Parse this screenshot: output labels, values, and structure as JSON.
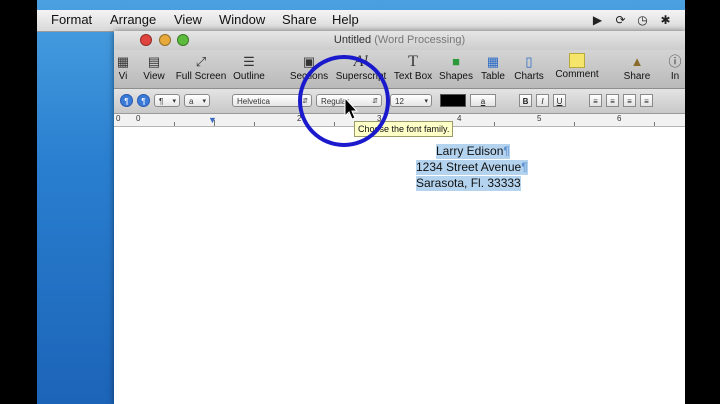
{
  "menubar": {
    "items": [
      "Format",
      "Arrange",
      "View",
      "Window",
      "Share",
      "Help"
    ],
    "status_icons": [
      "video-icon",
      "sync-icon",
      "time-machine-icon",
      "bluetooth-icon"
    ]
  },
  "window": {
    "title": "Untitled",
    "title_suffix": "(Word Processing)"
  },
  "toolbar": {
    "items": [
      {
        "label": "Vi",
        "icon": "view-icon"
      },
      {
        "label": "View",
        "icon": "view-menu-icon"
      },
      {
        "label": "Full Screen",
        "icon": "fullscreen-icon"
      },
      {
        "label": "Outline",
        "icon": "outline-icon"
      },
      {
        "label": "Sections",
        "icon": "sections-icon"
      },
      {
        "label": "Superscript",
        "icon": "superscript-icon"
      },
      {
        "label": "Text Box",
        "icon": "textbox-icon"
      },
      {
        "label": "Shapes",
        "icon": "shapes-icon"
      },
      {
        "label": "Table",
        "icon": "table-icon"
      },
      {
        "label": "Charts",
        "icon": "charts-icon"
      },
      {
        "label": "Comment",
        "icon": "comment-icon"
      },
      {
        "label": "Share",
        "icon": "share-icon"
      },
      {
        "label": "In",
        "icon": "inspector-icon"
      }
    ]
  },
  "formatbar": {
    "style_value": "¶",
    "char_style_value": "a",
    "font_family": "Helvetica",
    "font_typeface": "Regular",
    "font_size": "12",
    "text_color": "#000000",
    "highlight_label": "a",
    "bold": "B",
    "italic": "I",
    "underline": "U"
  },
  "ruler": {
    "numbers": [
      "0",
      "0",
      "2",
      "3",
      "4",
      "5",
      "6"
    ]
  },
  "tooltip": {
    "text": "Choose the font family."
  },
  "document": {
    "lines": [
      "Larry Edison",
      "1234 Street Avenue",
      "Sarasota, Fl. 33333"
    ],
    "pilcrow": "¶"
  },
  "colors": {
    "annotation_circle": "#1a1acc",
    "selection": "#b4d3ee",
    "desktop": "#2a7fd0"
  }
}
